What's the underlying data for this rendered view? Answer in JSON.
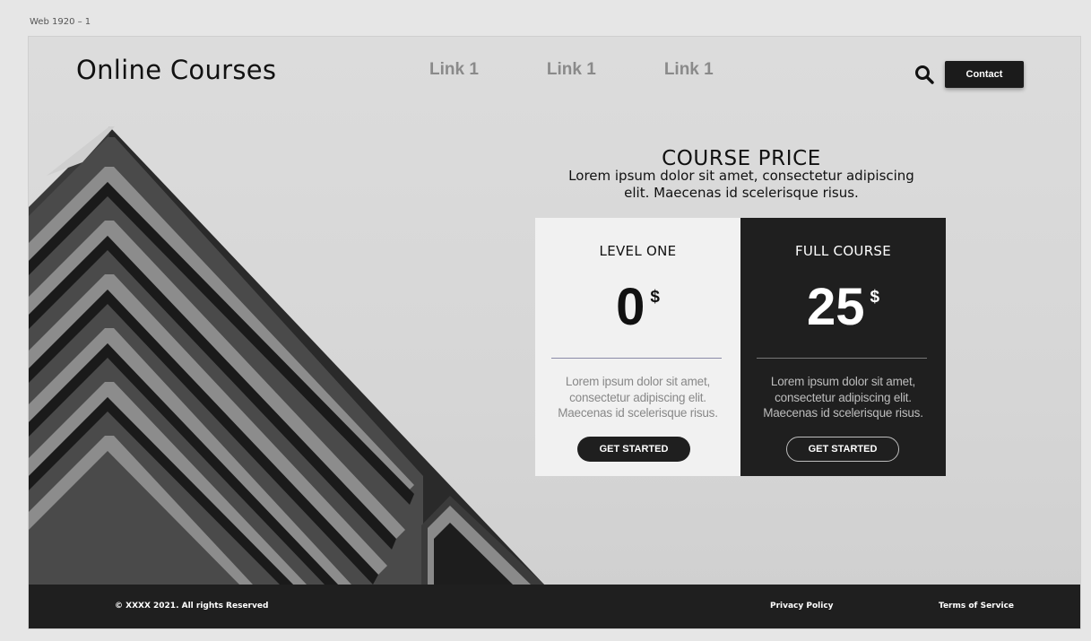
{
  "artboard": {
    "label": "Web 1920 – 1"
  },
  "header": {
    "brand": "Online Courses",
    "nav": [
      {
        "label": "Link 1"
      },
      {
        "label": "Link 1"
      },
      {
        "label": "Link 1"
      }
    ],
    "search_icon": "search-icon",
    "contact_label": "Contact"
  },
  "pricing": {
    "title": "COURSE PRICE",
    "subtitle": "Lorem ipsum dolor sit amet, consectetur adipiscing elit. Maecenas id scelerisque risus.",
    "cards": [
      {
        "level": "LEVEL ONE",
        "amount": "0",
        "currency": "$",
        "description": "Lorem ipsum dolor sit amet, consectetur adipiscing elit. Maecenas id scelerisque risus.",
        "cta": "GET STARTED"
      },
      {
        "level": "FULL COURSE",
        "amount": "25",
        "currency": "$",
        "description": "Lorem ipsum dolor sit amet, consectetur adipiscing elit. Maecenas id scelerisque risus.",
        "cta": "GET STARTED"
      }
    ]
  },
  "footer": {
    "copyright": "© XXXX 2021. All rights Reserved",
    "privacy": "Privacy Policy",
    "terms": "Terms of Service"
  },
  "colors": {
    "dark": "#1f1f1f",
    "light_card": "#f1f1f1",
    "nav_text": "#8a8a8a"
  }
}
